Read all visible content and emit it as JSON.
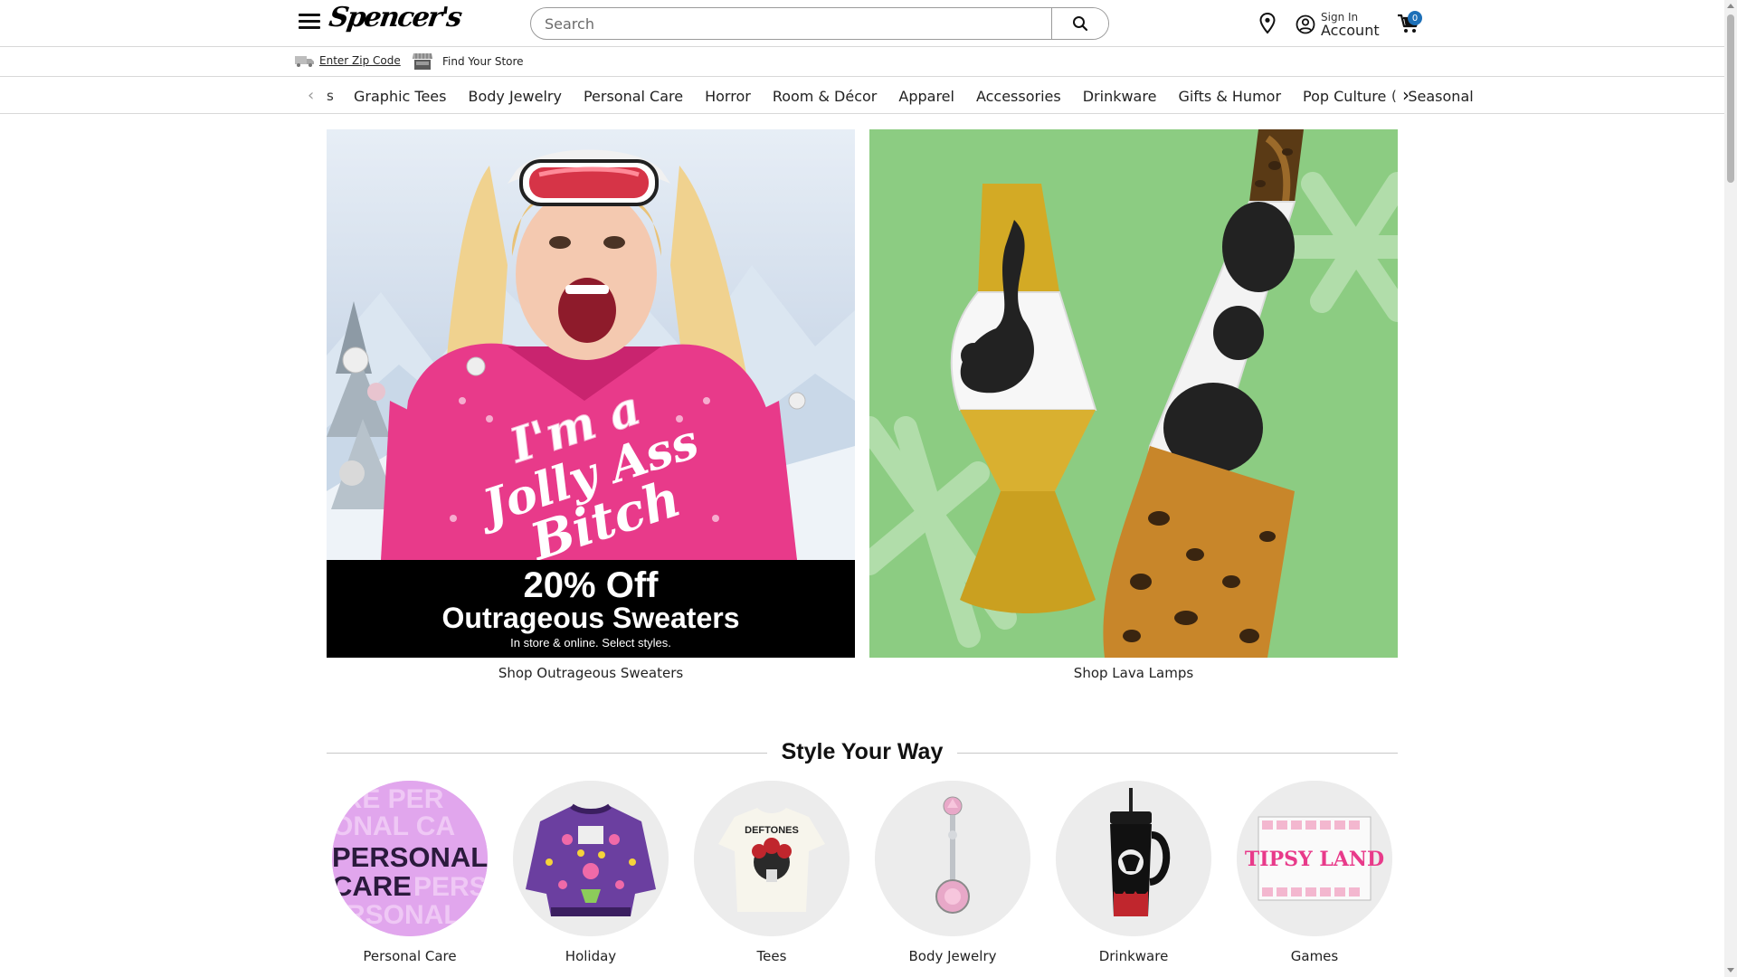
{
  "header": {
    "logo_text": "Spencer's",
    "search_placeholder": "Search",
    "sign_in": "Sign In",
    "account": "Account",
    "cart_count": "0"
  },
  "subheader": {
    "zip_label": "Enter Zip Code",
    "store_label": "Find Your Store"
  },
  "categories": {
    "left_clip": "s",
    "items": [
      "Graphic Tees",
      "Body Jewelry",
      "Personal Care",
      "Horror",
      "Room & Décor",
      "Apparel",
      "Accessories",
      "Drinkware",
      "Gifts & Humor",
      "Pop Culture",
      "Seasonal"
    ],
    "right_clip": "("
  },
  "banners": {
    "left": {
      "headline": "20% Off",
      "subhead": "Outrageous Sweaters",
      "fineprint": "In store & online. Select styles.",
      "sweater_text": "I'm a Jolly Ass Bitch",
      "caption": "Shop Outrageous Sweaters"
    },
    "right": {
      "caption": "Shop Lava Lamps"
    }
  },
  "style_your_way": {
    "title": "Style Your Way",
    "items": [
      {
        "label": "Personal Care",
        "image_text": "PERSONAL CARE"
      },
      {
        "label": "Holiday"
      },
      {
        "label": "Tees",
        "image_text": "DEFTONES"
      },
      {
        "label": "Body Jewelry"
      },
      {
        "label": "Drinkware"
      },
      {
        "label": "Games",
        "image_text": "TIPSY LAND"
      }
    ]
  },
  "colors": {
    "accent_blue": "#1d70b8",
    "banner_green": "#8ccc82",
    "sweater_pink": "#e83a8a"
  }
}
